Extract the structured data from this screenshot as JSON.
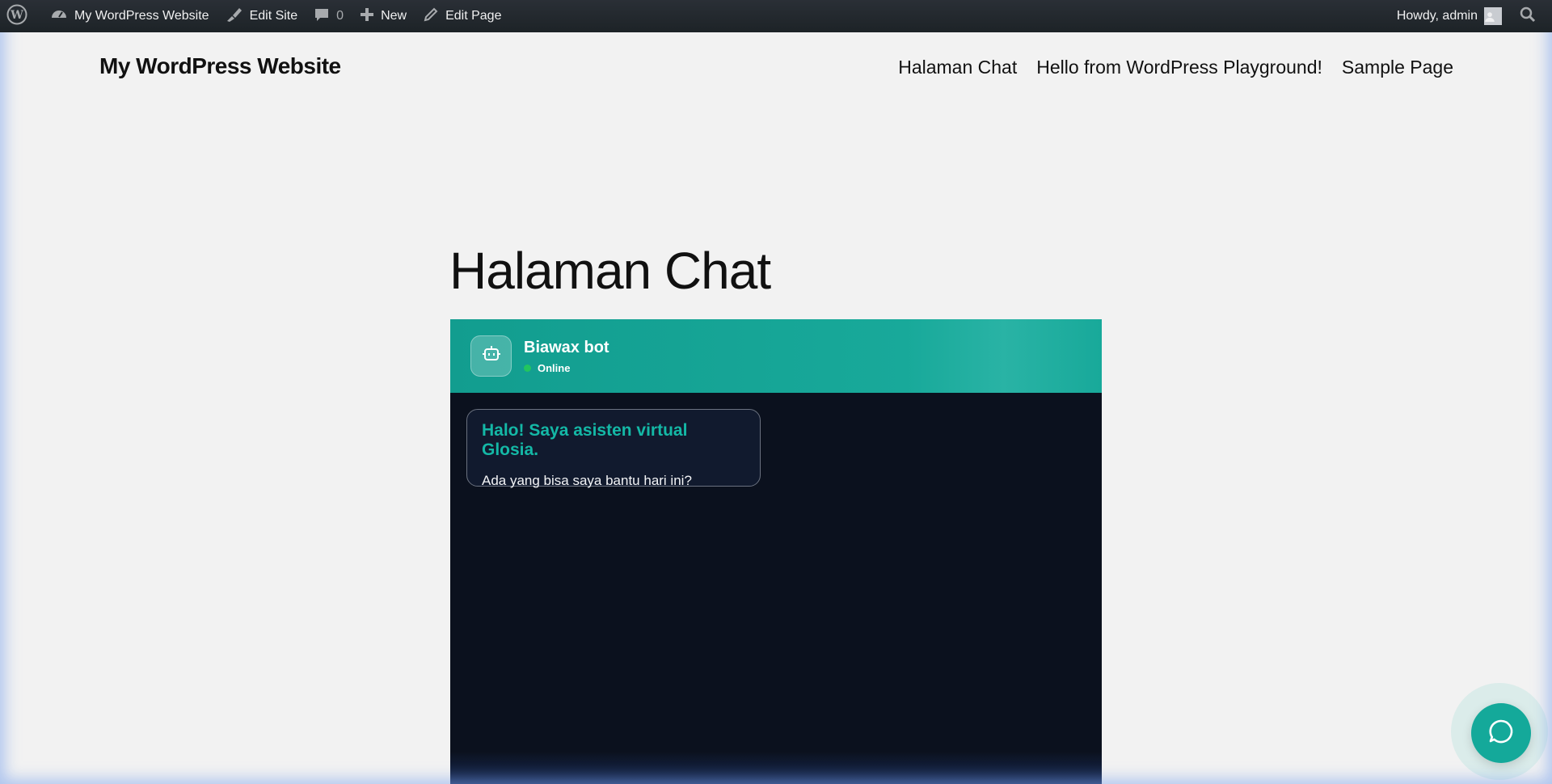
{
  "adminbar": {
    "site_name": "My WordPress Website",
    "edit_site": "Edit Site",
    "comments_count": "0",
    "new_label": "New",
    "edit_page": "Edit Page",
    "howdy": "Howdy, admin"
  },
  "site": {
    "title": "My WordPress Website",
    "nav": [
      "Halaman Chat",
      "Hello from WordPress Playground!",
      "Sample Page"
    ]
  },
  "page": {
    "title": "Halaman Chat"
  },
  "chat": {
    "bot_name": "Biawax bot",
    "status": "Online",
    "message_title": "Halo! Saya asisten virtual Glosia.",
    "message_body": "Ada yang bisa saya bantu hari ini?",
    "accent_color": "#14b8a6",
    "status_color": "#22c55e"
  },
  "icons": {
    "wp_logo": "wordpress-icon",
    "dashboard": "dashboard-icon",
    "edit_site": "brush-icon",
    "comments": "comment-icon",
    "new": "plus-icon",
    "edit": "pencil-icon",
    "search": "search-icon",
    "bot": "robot-icon",
    "chat": "chat-bubble-icon"
  }
}
